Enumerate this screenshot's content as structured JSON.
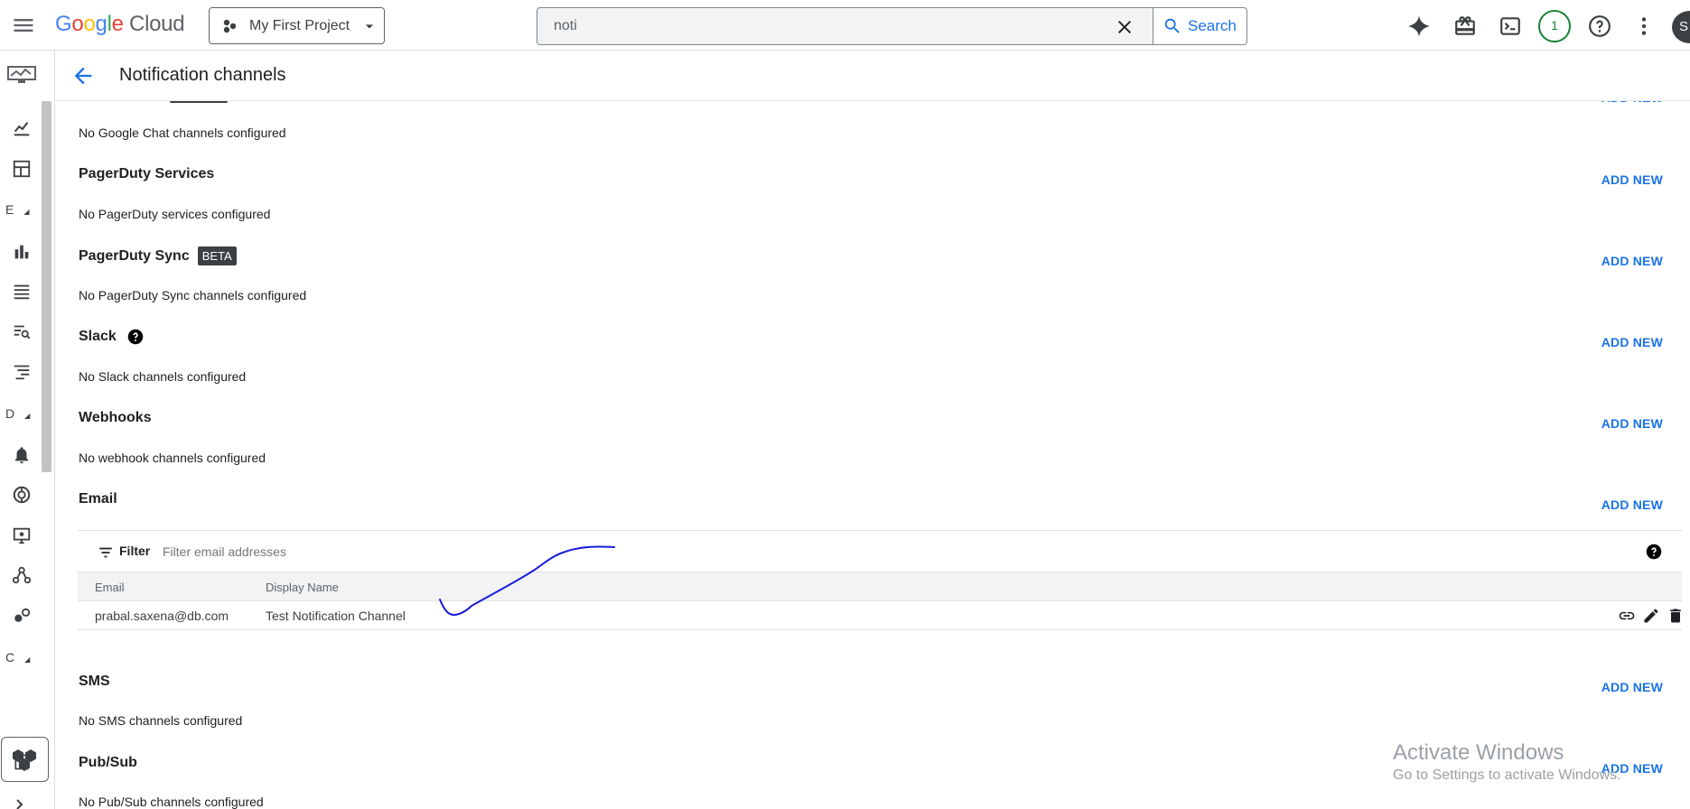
{
  "header": {
    "logo_google": "Google",
    "logo_cloud": "Cloud",
    "project_label": "My First Project",
    "search_value": "noti",
    "search_button": "Search",
    "notification_count": "1",
    "avatar_initial": "S"
  },
  "rail": {
    "letters": [
      "E",
      "D",
      "C"
    ]
  },
  "page": {
    "title": "Notification channels"
  },
  "sections": {
    "google_chat_empty": "No Google Chat channels configured",
    "pagerduty_services_title": "PagerDuty Services",
    "pagerduty_services_empty": "No PagerDuty services configured",
    "pagerduty_sync_title": "PagerDuty Sync",
    "pagerduty_sync_badge": "BETA",
    "pagerduty_sync_empty": "No PagerDuty Sync channels configured",
    "slack_title": "Slack",
    "slack_empty": "No Slack channels configured",
    "webhooks_title": "Webhooks",
    "webhooks_empty": "No webhook channels configured",
    "email_title": "Email",
    "sms_title": "SMS",
    "sms_empty": "No SMS channels configured",
    "pubsub_title": "Pub/Sub",
    "pubsub_empty": "No Pub/Sub channels configured",
    "add_new_label": "ADD NEW"
  },
  "email_table": {
    "filter_label": "Filter",
    "filter_placeholder": "Filter email addresses",
    "columns": [
      "Email",
      "Display Name"
    ],
    "rows": [
      {
        "email": "prabal.saxena@db.com",
        "display_name": "Test Notification Channel"
      }
    ]
  },
  "watermark": {
    "title": "Activate Windows",
    "subtitle": "Go to Settings to activate Windows."
  },
  "colors": {
    "accent": "#1a73e8",
    "success": "#188038",
    "annotation_ink": "#1a1adb"
  }
}
